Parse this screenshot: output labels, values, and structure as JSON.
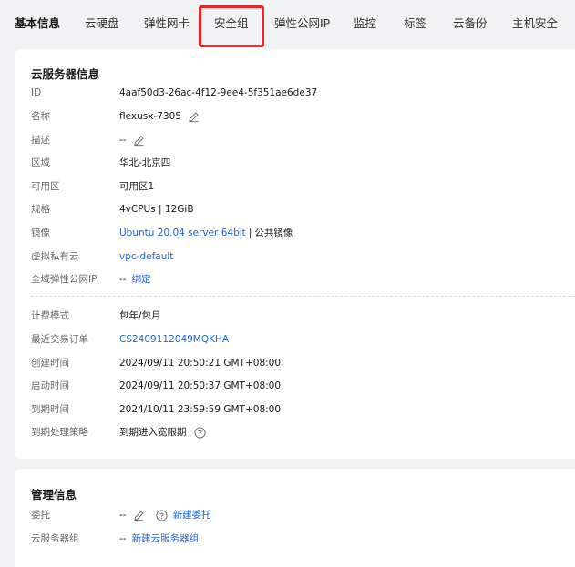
{
  "tabs": [
    {
      "label": "基本信息",
      "active": true
    },
    {
      "label": "云硬盘"
    },
    {
      "label": "弹性网卡"
    },
    {
      "label": "安全组"
    },
    {
      "label": "弹性公网IP"
    },
    {
      "label": "监控"
    },
    {
      "label": "标签"
    },
    {
      "label": "云备份"
    },
    {
      "label": "主机安全"
    }
  ],
  "server_info": {
    "title": "云服务器信息",
    "id": {
      "label": "ID",
      "value": "4aaf50d3-26ac-4f12-9ee4-5f351ae6de37"
    },
    "name": {
      "label": "名称",
      "value": "flexusx-7305"
    },
    "description": {
      "label": "描述",
      "value": "--"
    },
    "region": {
      "label": "区域",
      "value": "华北-北京四"
    },
    "az": {
      "label": "可用区",
      "value": "可用区1"
    },
    "spec": {
      "label": "规格",
      "value": "4vCPUs | 12GiB"
    },
    "image": {
      "label": "镜像",
      "link": "Ubuntu 20.04 server 64bit",
      "sep": "|",
      "suffix": "公共镜像"
    },
    "vpc": {
      "label": "虚拟私有云",
      "link": "vpc-default"
    },
    "eip": {
      "label": "全域弹性公网IP",
      "value": "--",
      "link": "绑定"
    },
    "billing": {
      "label": "计费模式",
      "value": "包年/包月"
    },
    "order": {
      "label": "最近交易订单",
      "link": "CS2409112049MQKHA"
    },
    "created": {
      "label": "创建时间",
      "value": "2024/09/11 20:50:21 GMT+08:00"
    },
    "started": {
      "label": "启动时间",
      "value": "2024/09/11 20:50:37 GMT+08:00"
    },
    "expires": {
      "label": "到期时间",
      "value": "2024/10/11 23:59:59 GMT+08:00"
    },
    "expiry_policy": {
      "label": "到期处理策略",
      "value": "到期进入宽限期"
    }
  },
  "management": {
    "title": "管理信息",
    "delegation": {
      "label": "委托",
      "value": "--",
      "link": "新建委托"
    },
    "server_group": {
      "label": "云服务器组",
      "value": "--",
      "link": "新建云服务器组"
    }
  },
  "colors": {
    "link": "#1a65d6",
    "highlight": "#f12424",
    "background": "#f1f2f4"
  },
  "icons": [
    "edit-icon",
    "help-icon"
  ]
}
